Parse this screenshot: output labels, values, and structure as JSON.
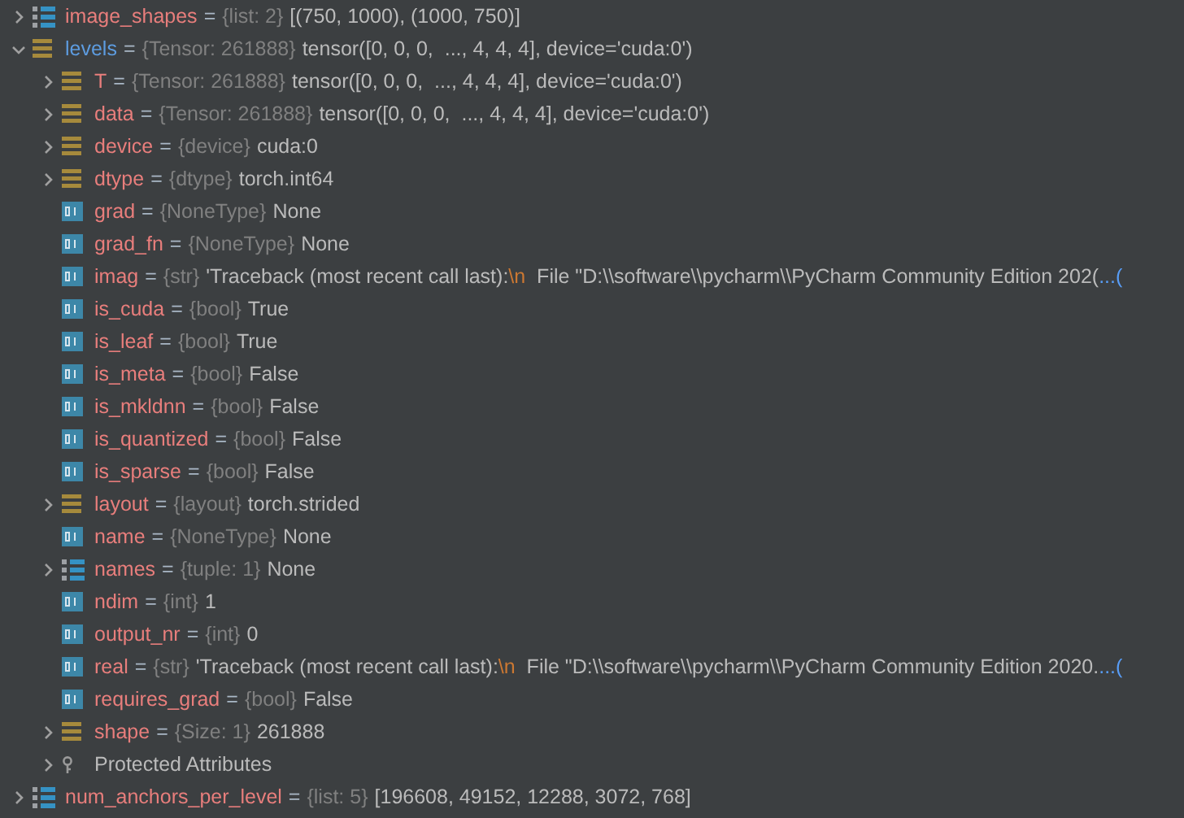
{
  "variables": [
    {
      "name": "image_shapes",
      "kind": "list",
      "expanded": false,
      "highlighted": false,
      "sep": "=",
      "type": "{list: 2}",
      "value": "[(750, 1000), (1000, 750)]"
    },
    {
      "name": "levels",
      "kind": "object",
      "expanded": true,
      "highlighted": true,
      "sep": "=",
      "type": "{Tensor: 261888}",
      "value": "tensor([0, 0, 0,  ..., 4, 4, 4], device='cuda:0')",
      "children": [
        {
          "name": "T",
          "kind": "object",
          "expanded": false,
          "sep": "=",
          "type": "{Tensor: 261888}",
          "value": "tensor([0, 0, 0,  ..., 4, 4, 4], device='cuda:0')"
        },
        {
          "name": "data",
          "kind": "object",
          "expanded": false,
          "sep": "=",
          "type": "{Tensor: 261888}",
          "value": "tensor([0, 0, 0,  ..., 4, 4, 4], device='cuda:0')"
        },
        {
          "name": "device",
          "kind": "object",
          "expanded": false,
          "sep": "=",
          "type": "{device}",
          "value": "cuda:0"
        },
        {
          "name": "dtype",
          "kind": "object",
          "expanded": false,
          "sep": "=",
          "type": "{dtype}",
          "value": "torch.int64"
        },
        {
          "name": "grad",
          "kind": "primitive",
          "sep": "=",
          "type": "{NoneType}",
          "value": "None"
        },
        {
          "name": "grad_fn",
          "kind": "primitive",
          "sep": "=",
          "type": "{NoneType}",
          "value": "None"
        },
        {
          "name": "imag",
          "kind": "primitive",
          "sep": "=",
          "type": "{str}",
          "value": "'Traceback (most recent call last):",
          "escape": "\\n",
          "value_rest": "  File \"D:\\\\software\\\\pycharm\\\\PyCharm Community Edition 202(",
          "more": "...("
        },
        {
          "name": "is_cuda",
          "kind": "primitive",
          "sep": "=",
          "type": "{bool}",
          "value": "True"
        },
        {
          "name": "is_leaf",
          "kind": "primitive",
          "sep": "=",
          "type": "{bool}",
          "value": "True"
        },
        {
          "name": "is_meta",
          "kind": "primitive",
          "sep": "=",
          "type": "{bool}",
          "value": "False"
        },
        {
          "name": "is_mkldnn",
          "kind": "primitive",
          "sep": "=",
          "type": "{bool}",
          "value": "False"
        },
        {
          "name": "is_quantized",
          "kind": "primitive",
          "sep": "=",
          "type": "{bool}",
          "value": "False"
        },
        {
          "name": "is_sparse",
          "kind": "primitive",
          "sep": "=",
          "type": "{bool}",
          "value": "False"
        },
        {
          "name": "layout",
          "kind": "object",
          "expanded": false,
          "sep": "=",
          "type": "{layout}",
          "value": "torch.strided"
        },
        {
          "name": "name",
          "kind": "primitive",
          "sep": "=",
          "type": "{NoneType}",
          "value": "None"
        },
        {
          "name": "names",
          "kind": "list",
          "expanded": false,
          "sep": "=",
          "type": "{tuple: 1}",
          "value": "None"
        },
        {
          "name": "ndim",
          "kind": "primitive",
          "sep": "=",
          "type": "{int}",
          "value": "1"
        },
        {
          "name": "output_nr",
          "kind": "primitive",
          "sep": "=",
          "type": "{int}",
          "value": "0"
        },
        {
          "name": "real",
          "kind": "primitive",
          "sep": "=",
          "type": "{str}",
          "value": "'Traceback (most recent call last):",
          "escape": "\\n",
          "value_rest": "  File \"D:\\\\software\\\\pycharm\\\\PyCharm Community Edition 2020.",
          "more": "...("
        },
        {
          "name": "requires_grad",
          "kind": "primitive",
          "sep": "=",
          "type": "{bool}",
          "value": "False"
        },
        {
          "name": "shape",
          "kind": "object",
          "expanded": false,
          "sep": "=",
          "type": "{Size: 1}",
          "value": "261888"
        },
        {
          "name": "Protected Attributes",
          "kind": "protected",
          "expanded": false
        }
      ]
    },
    {
      "name": "num_anchors_per_level",
      "kind": "list",
      "expanded": false,
      "highlighted": false,
      "sep": "=",
      "type": "{list: 5}",
      "value": "[196608, 49152, 12288, 3072, 768]"
    }
  ]
}
